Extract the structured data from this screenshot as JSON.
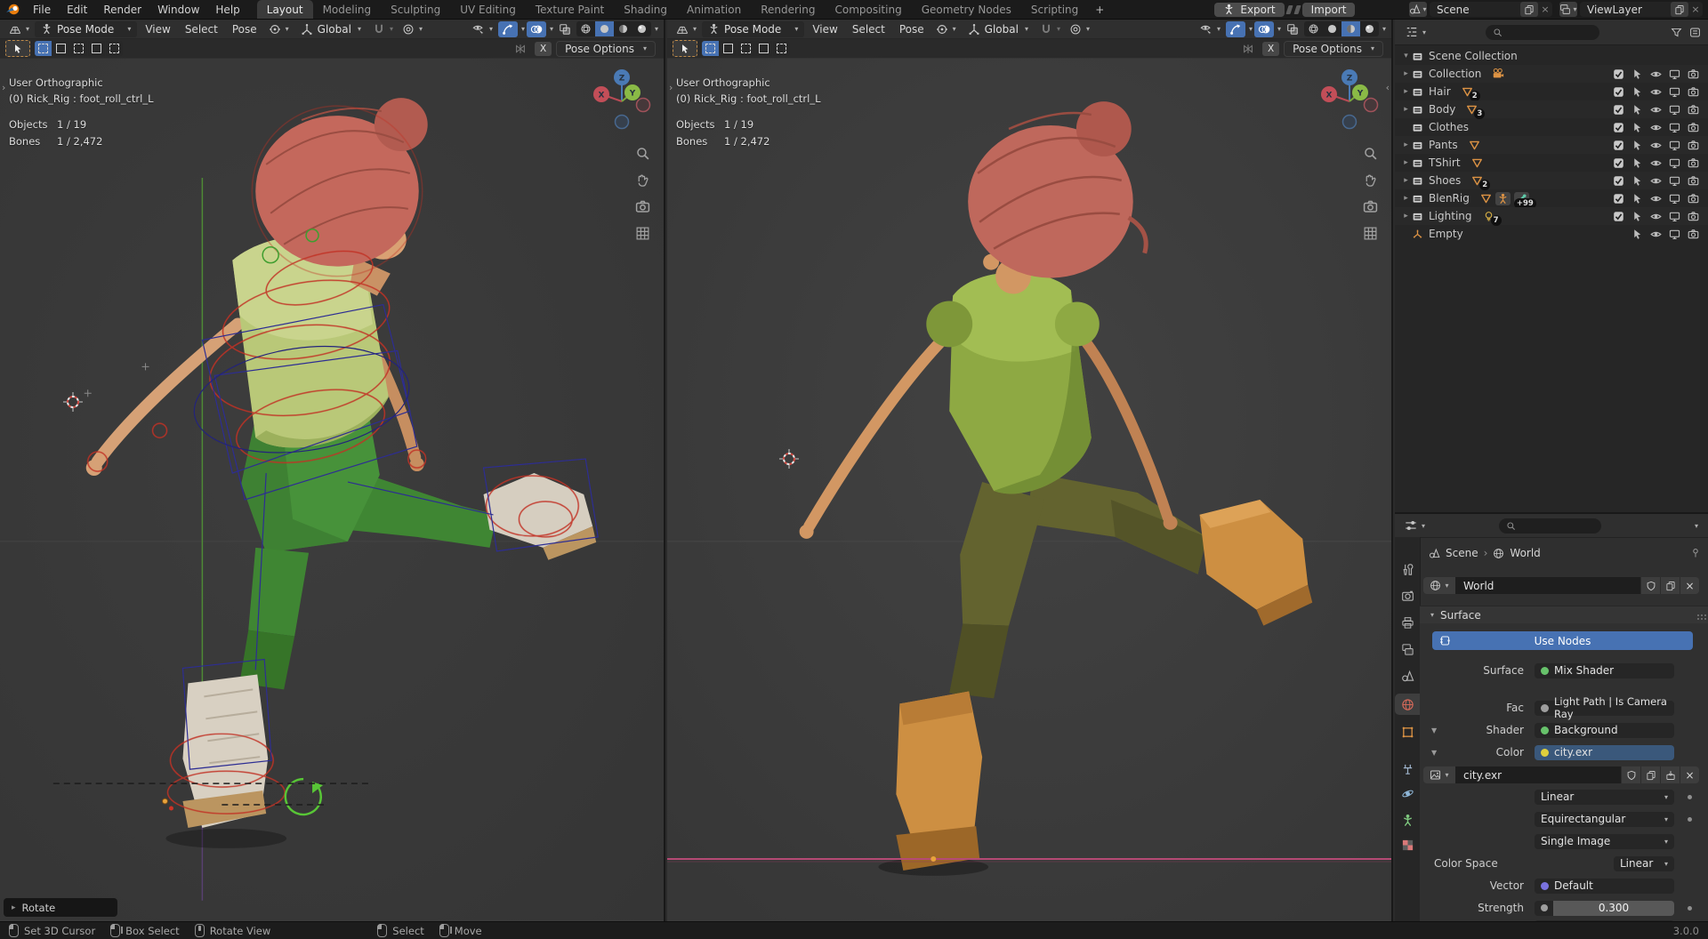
{
  "topbar": {
    "menus": [
      "File",
      "Edit",
      "Render",
      "Window",
      "Help"
    ],
    "workspaces": [
      "Layout",
      "Modeling",
      "Sculpting",
      "UV Editing",
      "Texture Paint",
      "Shading",
      "Animation",
      "Rendering",
      "Compositing",
      "Geometry Nodes",
      "Scripting"
    ],
    "active_workspace": "Layout",
    "new_workspace_label": "+",
    "export_label": "Export",
    "import_label": "Import",
    "scene_value": "Scene",
    "view_layer_value": "ViewLayer"
  },
  "viewport": {
    "mode": "Pose Mode",
    "menu_view": "View",
    "menu_select": "Select",
    "menu_pose": "Pose",
    "orientation": "Global",
    "mirror_x_label": "X",
    "pose_options_label": "Pose Options",
    "view_name": "User Orthographic",
    "active_item": "(0) Rick_Rig : foot_roll_ctrl_L",
    "stats": [
      {
        "label": "Objects",
        "value": "1 / 19"
      },
      {
        "label": "Bones",
        "value": "1 / 2,472"
      }
    ],
    "axis_x": "X",
    "axis_y": "Y",
    "axis_z": "Z",
    "operator_label": "Rotate"
  },
  "outliner": {
    "root_label": "Scene Collection",
    "items": [
      {
        "name": "Collection",
        "badge": ""
      },
      {
        "name": "Hair",
        "badge": "2"
      },
      {
        "name": "Body",
        "badge": "3"
      },
      {
        "name": "Clothes",
        "badge": ""
      },
      {
        "name": "Pants",
        "badge": ""
      },
      {
        "name": "TShirt",
        "badge": ""
      },
      {
        "name": "Shoes",
        "badge": "2"
      },
      {
        "name": "BlenRig",
        "badge": "+99"
      },
      {
        "name": "Lighting",
        "badge": "7"
      },
      {
        "name": "Empty",
        "badge": ""
      }
    ]
  },
  "properties": {
    "breadcrumb_scene": "Scene",
    "breadcrumb_world": "World",
    "world_name": "World",
    "panel_title": "Surface",
    "use_nodes_label": "Use Nodes",
    "surface_label": "Surface",
    "surface_value": "Mix Shader",
    "fac_label": "Fac",
    "fac_value": "Light Path | Is Camera Ray",
    "shader_label": "Shader",
    "shader_value": "Background",
    "color_label": "Color",
    "color_value": "city.exr",
    "image_name": "city.exr",
    "interpolation": "Linear",
    "projection": "Equirectangular",
    "source": "Single Image",
    "color_space_label": "Color Space",
    "color_space_value": "Linear",
    "vector_label": "Vector",
    "vector_value": "Default",
    "strength_label": "Strength",
    "strength_value": "0.300"
  },
  "statusbar": {
    "hints": [
      {
        "label": "Set 3D Cursor"
      },
      {
        "label": "Box Select"
      },
      {
        "label": "Rotate View"
      },
      {
        "label": "Select"
      },
      {
        "label": "Move"
      }
    ],
    "version": "3.0.0"
  },
  "colors": {
    "accent": "#4772b3",
    "axis_x": "#c24e58",
    "axis_y": "#8aba46",
    "axis_z": "#4a7ab5",
    "socket_shader": "#67c26b",
    "socket_value": "#9e9e9e",
    "socket_color": "#dfcf3c",
    "socket_vector": "#7a72de",
    "selection_highlight": "#3a587b"
  }
}
